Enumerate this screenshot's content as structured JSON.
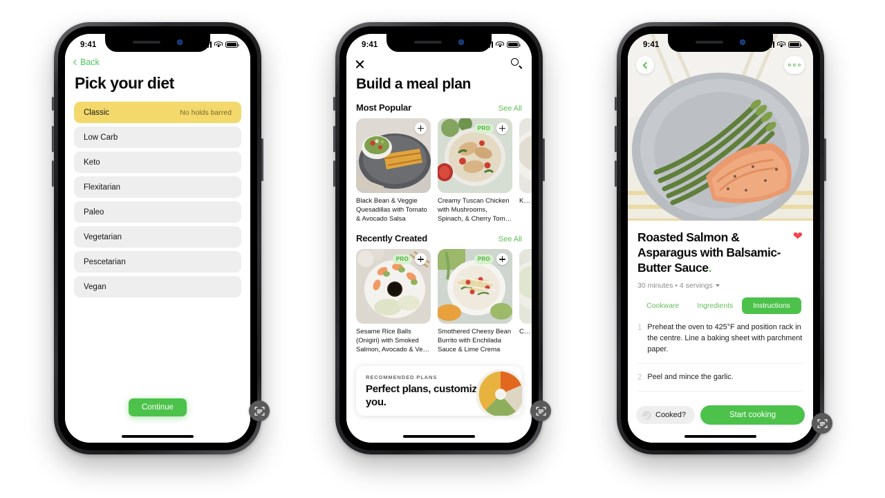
{
  "phones": [
    {
      "name": "pick-your-diet",
      "status_bar": {
        "time": "9:41",
        "cellular_icon": "signal-bars-icon",
        "wifi_icon": "wifi-icon",
        "battery_icon": "battery-icon"
      },
      "back_label": "Back",
      "title": "Pick your diet",
      "diets": [
        {
          "label": "Classic",
          "note": "No holds barred",
          "selected": true
        },
        {
          "label": "Low Carb",
          "note": "",
          "selected": false
        },
        {
          "label": "Keto",
          "note": "",
          "selected": false
        },
        {
          "label": "Flexitarian",
          "note": "",
          "selected": false
        },
        {
          "label": "Paleo",
          "note": "",
          "selected": false
        },
        {
          "label": "Vegetarian",
          "note": "",
          "selected": false
        },
        {
          "label": "Pescetarian",
          "note": "",
          "selected": false
        },
        {
          "label": "Vegan",
          "note": "",
          "selected": false
        }
      ],
      "continue_label": "Continue"
    },
    {
      "name": "build-a-meal-plan",
      "status_bar": {
        "time": "9:41"
      },
      "close_icon": "close-icon",
      "search_icon": "search-icon",
      "title": "Build a meal plan",
      "sections": [
        {
          "heading": "Most Popular",
          "see_all": "See All",
          "cards": [
            {
              "name": "Black Bean & Veggie Quesadillas with Tomato & Avocado Salsa",
              "pro": false,
              "add": "+"
            },
            {
              "name": "Creamy Tuscan Chicken with Mushrooms, Spinach, & Cherry Tom…",
              "pro": true,
              "pro_label": "PRO",
              "add": "+"
            },
            {
              "name": "K… B…",
              "pro": false,
              "add": "+"
            }
          ]
        },
        {
          "heading": "Recently Created",
          "see_all": "See All",
          "cards": [
            {
              "name": "Sesame Rice Balls (Onigiri) with Smoked Salmon, Avocado & Ve…",
              "pro": true,
              "pro_label": "PRO",
              "add": "+"
            },
            {
              "name": "Smothered Cheesy Bean Burrito with Enchilada Sauce & Lime Crema",
              "pro": true,
              "pro_label": "PRO",
              "add": "+"
            },
            {
              "name": "C… (P… D…",
              "pro": false,
              "add": "+"
            }
          ]
        }
      ],
      "banner": {
        "kicker": "RECOMMENDED PLANS",
        "title": "Perfect plans, customized for you."
      }
    },
    {
      "name": "recipe-detail",
      "status_bar": {
        "time": "9:41"
      },
      "back_icon": "chevron-left-icon",
      "more_icon": "more-options-icon",
      "hero_image": "roasted-salmon-asparagus-photo",
      "title": "Roasted Salmon & Asparagus with Balsamic-Butter Sauce",
      "title_dot": ".",
      "favorite_icon": "heart-icon",
      "meta": "30 minutes • 4 servings",
      "tabs": [
        {
          "label": "Cookware",
          "active": false
        },
        {
          "label": "Ingredients",
          "active": false
        },
        {
          "label": "Instructions",
          "active": true
        }
      ],
      "steps": [
        {
          "n": "1",
          "text": "Preheat the oven to 425°F and position rack in the centre. Line a baking sheet with parchment paper."
        },
        {
          "n": "2",
          "text": "Peel and mince the garlic."
        }
      ],
      "cooked_label": "Cooked?",
      "start_label": "Start cooking"
    }
  ],
  "floating_action": {
    "icon": "scan-text-icon"
  },
  "colors": {
    "green": "#4cc24a",
    "green_text": "#5fbf57",
    "yellow": "#f3d96c",
    "gray_row": "#eeeeef",
    "heart_red": "#f2454b"
  }
}
